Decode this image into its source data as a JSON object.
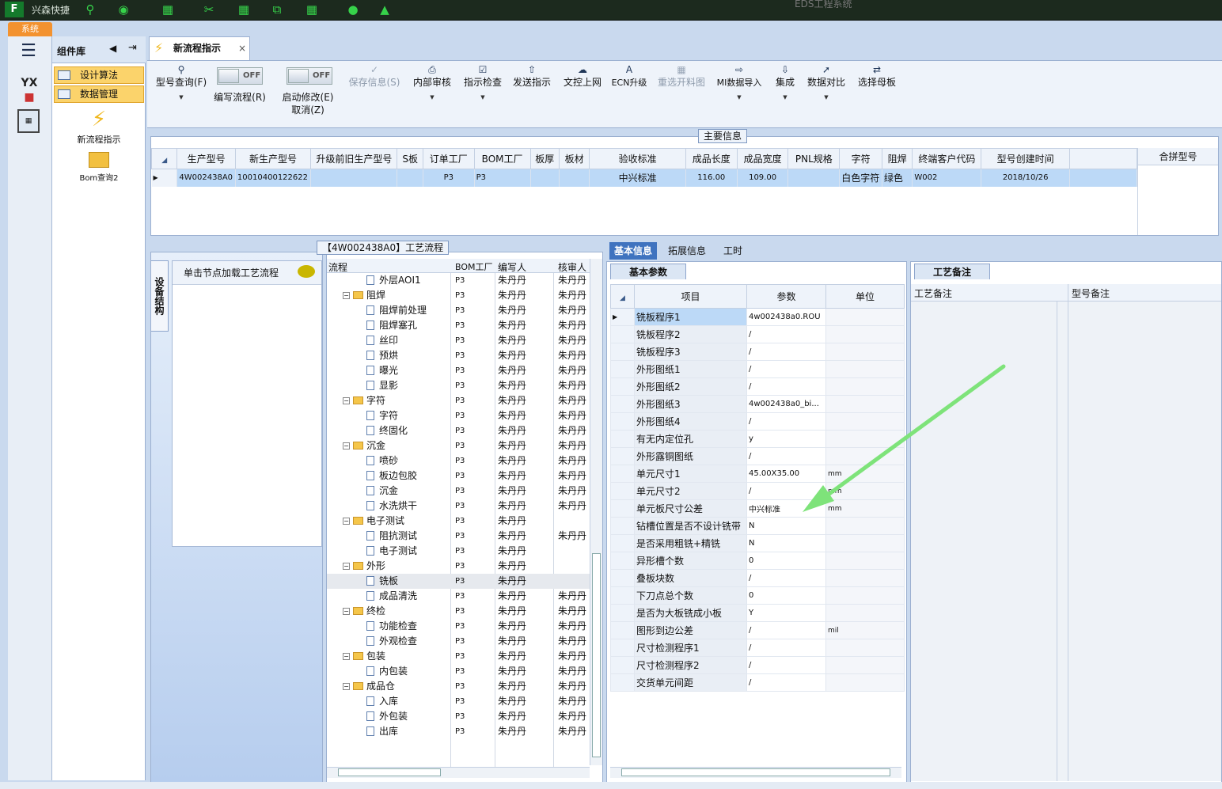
{
  "topbar": {
    "logo": "F",
    "app_name": "兴森快捷",
    "window_title": "EDS工程系统"
  },
  "system_tab": "系统",
  "component_lib": {
    "title": "组件库",
    "items": [
      "设计算法",
      "数据管理"
    ],
    "launchers": [
      "新流程指示",
      "Bom查询2"
    ]
  },
  "doc_tab": {
    "title": "新流程指示",
    "close": "×"
  },
  "ribbon": {
    "query": "型号查询(F)",
    "edit_toggle": "OFF",
    "edit_label": "编写流程(R)",
    "mod_toggle": "OFF",
    "mod_label1": "启动修改(E)",
    "mod_label2": "取消(Z)",
    "save": "保存信息(S)",
    "audit": "内部审核",
    "check": "指示检查",
    "send": "发送指示",
    "upload": "文控上网",
    "ecn": "ECN升级",
    "redo": "重选开料图",
    "mi": "MI数据导入",
    "integrate": "集成",
    "compare": "数据对比",
    "mother": "选择母板"
  },
  "main_info": {
    "legend": "主要信息",
    "columns": [
      "生产型号",
      "新生产型号",
      "升级前旧生产型号",
      "S板",
      "订单工厂",
      "BOM工厂",
      "板厚",
      "板材",
      "验收标准",
      "成品长度",
      "成品宽度",
      "PNL规格",
      "字符",
      "阻焊",
      "终端客户代码",
      "型号创建时间"
    ],
    "row": [
      "4W002438A0",
      "10010400122622",
      "",
      "",
      "P3",
      "P3",
      "",
      "",
      "中兴标准",
      "116.00",
      "109.00",
      "",
      "白色字符",
      "绿色",
      "W002",
      "2018/10/26"
    ],
    "side_header": "合拼型号"
  },
  "left_panel": {
    "vtab": "设备结构",
    "node_hint": "单击节点加载工艺流程"
  },
  "tree": {
    "legend": "【4W002438A0】工艺流程",
    "columns": [
      "流程",
      "BOM工厂",
      "编写人",
      "核审人"
    ],
    "rows": [
      {
        "level": 2,
        "label": "外层AOI1",
        "bom": "P3",
        "writer": "朱丹丹",
        "reviewer": "朱丹丹"
      },
      {
        "level": 1,
        "label": "阻焊",
        "bom": "P3",
        "writer": "朱丹丹",
        "reviewer": "朱丹丹"
      },
      {
        "level": 2,
        "label": "阻焊前处理",
        "bom": "P3",
        "writer": "朱丹丹",
        "reviewer": "朱丹丹"
      },
      {
        "level": 2,
        "label": "阻焊塞孔",
        "bom": "P3",
        "writer": "朱丹丹",
        "reviewer": "朱丹丹"
      },
      {
        "level": 2,
        "label": "丝印",
        "bom": "P3",
        "writer": "朱丹丹",
        "reviewer": "朱丹丹"
      },
      {
        "level": 2,
        "label": "预烘",
        "bom": "P3",
        "writer": "朱丹丹",
        "reviewer": "朱丹丹"
      },
      {
        "level": 2,
        "label": "曝光",
        "bom": "P3",
        "writer": "朱丹丹",
        "reviewer": "朱丹丹"
      },
      {
        "level": 2,
        "label": "显影",
        "bom": "P3",
        "writer": "朱丹丹",
        "reviewer": "朱丹丹"
      },
      {
        "level": 1,
        "label": "字符",
        "bom": "P3",
        "writer": "朱丹丹",
        "reviewer": "朱丹丹"
      },
      {
        "level": 2,
        "label": "字符",
        "bom": "P3",
        "writer": "朱丹丹",
        "reviewer": "朱丹丹"
      },
      {
        "level": 2,
        "label": "终固化",
        "bom": "P3",
        "writer": "朱丹丹",
        "reviewer": "朱丹丹"
      },
      {
        "level": 1,
        "label": "沉金",
        "bom": "P3",
        "writer": "朱丹丹",
        "reviewer": "朱丹丹"
      },
      {
        "level": 2,
        "label": "喷砂",
        "bom": "P3",
        "writer": "朱丹丹",
        "reviewer": "朱丹丹"
      },
      {
        "level": 2,
        "label": "板边包胶",
        "bom": "P3",
        "writer": "朱丹丹",
        "reviewer": "朱丹丹"
      },
      {
        "level": 2,
        "label": "沉金",
        "bom": "P3",
        "writer": "朱丹丹",
        "reviewer": "朱丹丹"
      },
      {
        "level": 2,
        "label": "水洗烘干",
        "bom": "P3",
        "writer": "朱丹丹",
        "reviewer": "朱丹丹"
      },
      {
        "level": 1,
        "label": "电子测试",
        "bom": "P3",
        "writer": "朱丹丹",
        "reviewer": ""
      },
      {
        "level": 2,
        "label": "阻抗测试",
        "bom": "P3",
        "writer": "朱丹丹",
        "reviewer": "朱丹丹"
      },
      {
        "level": 2,
        "label": "电子测试",
        "bom": "P3",
        "writer": "朱丹丹",
        "reviewer": ""
      },
      {
        "level": 1,
        "label": "外形",
        "bom": "P3",
        "writer": "朱丹丹",
        "reviewer": ""
      },
      {
        "level": 2,
        "label": "铣板",
        "bom": "P3",
        "writer": "朱丹丹",
        "reviewer": "",
        "selected": true
      },
      {
        "level": 2,
        "label": "成品清洗",
        "bom": "P3",
        "writer": "朱丹丹",
        "reviewer": "朱丹丹"
      },
      {
        "level": 1,
        "label": "终检",
        "bom": "P3",
        "writer": "朱丹丹",
        "reviewer": "朱丹丹"
      },
      {
        "level": 2,
        "label": "功能检查",
        "bom": "P3",
        "writer": "朱丹丹",
        "reviewer": "朱丹丹"
      },
      {
        "level": 2,
        "label": "外观检查",
        "bom": "P3",
        "writer": "朱丹丹",
        "reviewer": "朱丹丹"
      },
      {
        "level": 1,
        "label": "包装",
        "bom": "P3",
        "writer": "朱丹丹",
        "reviewer": "朱丹丹"
      },
      {
        "level": 2,
        "label": "内包装",
        "bom": "P3",
        "writer": "朱丹丹",
        "reviewer": "朱丹丹"
      },
      {
        "level": 1,
        "label": "成品仓",
        "bom": "P3",
        "writer": "朱丹丹",
        "reviewer": "朱丹丹"
      },
      {
        "level": 2,
        "label": "入库",
        "bom": "P3",
        "writer": "朱丹丹",
        "reviewer": "朱丹丹"
      },
      {
        "level": 2,
        "label": "外包装",
        "bom": "P3",
        "writer": "朱丹丹",
        "reviewer": "朱丹丹"
      },
      {
        "level": 2,
        "label": "出库",
        "bom": "P3",
        "writer": "朱丹丹",
        "reviewer": "朱丹丹"
      }
    ]
  },
  "right_tabs": [
    "基本信息",
    "拓展信息",
    "工时"
  ],
  "basic_params": {
    "caption": "基本参数",
    "columns": [
      "项目",
      "参数",
      "单位"
    ],
    "rows": [
      [
        "铣板程序1",
        "4w002438a0.ROU",
        ""
      ],
      [
        "铣板程序2",
        "/",
        ""
      ],
      [
        "铣板程序3",
        "/",
        ""
      ],
      [
        "外形图纸1",
        "/",
        ""
      ],
      [
        "外形图纸2",
        "/",
        ""
      ],
      [
        "外形图纸3",
        "4w002438a0_bi...",
        ""
      ],
      [
        "外形图纸4",
        "/",
        ""
      ],
      [
        "有无内定位孔",
        "y",
        ""
      ],
      [
        "外形露铜图纸",
        "/",
        ""
      ],
      [
        "单元尺寸1",
        "45.00X35.00",
        "mm"
      ],
      [
        "单元尺寸2",
        "/",
        "mm"
      ],
      [
        "单元板尺寸公差",
        "中兴标准",
        "mm"
      ],
      [
        "钻槽位置是否不设计铣带",
        "N",
        ""
      ],
      [
        "是否采用粗铣+精铣",
        "N",
        ""
      ],
      [
        "异形槽个数",
        "0",
        ""
      ],
      [
        "叠板块数",
        "/",
        ""
      ],
      [
        "下刀点总个数",
        "0",
        ""
      ],
      [
        "是否为大板铣成小板",
        "Y",
        ""
      ],
      [
        "图形到边公差",
        "/",
        "mil"
      ],
      [
        "尺寸检测程序1",
        "/",
        ""
      ],
      [
        "尺寸检测程序2",
        "/",
        ""
      ],
      [
        "交货单元间距",
        "/",
        ""
      ]
    ]
  },
  "process_notes": {
    "caption": "工艺备注",
    "columns": [
      "工艺备注",
      "型号备注"
    ]
  }
}
